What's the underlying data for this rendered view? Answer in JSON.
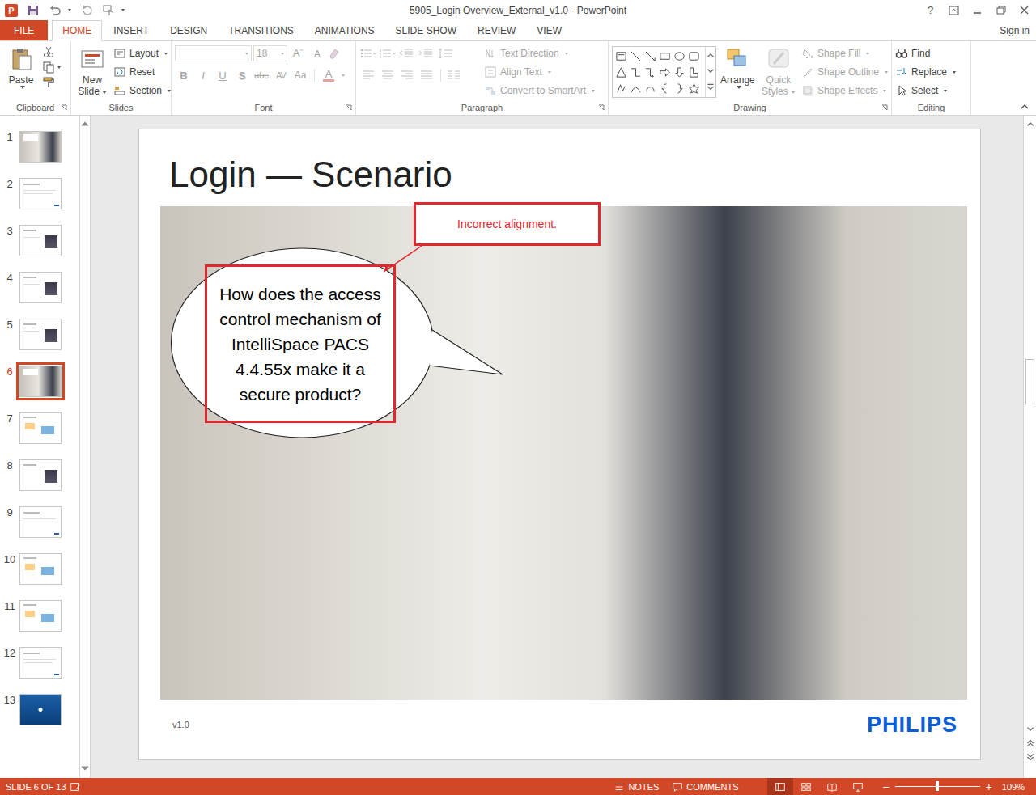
{
  "window": {
    "title": "5905_Login Overview_External_v1.0 - PowerPoint",
    "app_icon": "P",
    "help": "?"
  },
  "tabs": [
    {
      "label": "FILE",
      "selected": false,
      "kind": "file"
    },
    {
      "label": "HOME",
      "selected": true,
      "kind": "tab"
    },
    {
      "label": "INSERT",
      "selected": false,
      "kind": "tab"
    },
    {
      "label": "DESIGN",
      "selected": false,
      "kind": "tab"
    },
    {
      "label": "TRANSITIONS",
      "selected": false,
      "kind": "tab"
    },
    {
      "label": "ANIMATIONS",
      "selected": false,
      "kind": "tab"
    },
    {
      "label": "SLIDE SHOW",
      "selected": false,
      "kind": "tab"
    },
    {
      "label": "REVIEW",
      "selected": false,
      "kind": "tab"
    },
    {
      "label": "VIEW",
      "selected": false,
      "kind": "tab"
    }
  ],
  "account": {
    "label": "Sign in"
  },
  "ribbon": {
    "clipboard": {
      "label": "Clipboard",
      "paste": "Paste"
    },
    "slides": {
      "label": "Slides",
      "new_slide": "New Slide",
      "items": [
        {
          "label": "Layout",
          "dropdown": true
        },
        {
          "label": "Reset",
          "dropdown": false
        },
        {
          "label": "Section",
          "dropdown": true
        }
      ]
    },
    "font": {
      "label": "Font",
      "disabled": true,
      "size": "18",
      "grow": "A",
      "shrink": "A",
      "styles": [
        {
          "label": "B",
          "kind": "bold"
        },
        {
          "label": "I",
          "kind": "italic"
        },
        {
          "label": "U",
          "kind": "underline"
        },
        {
          "label": "S",
          "kind": "shadow"
        },
        {
          "label": "abc",
          "kind": "strike"
        },
        {
          "label": "AV",
          "kind": "spacing"
        },
        {
          "label": "Aa",
          "kind": "case"
        }
      ],
      "color": "A"
    },
    "paragraph": {
      "label": "Paragraph",
      "disabled": true,
      "items": [
        "Text Direction",
        "Align Text",
        "Convert to SmartArt"
      ]
    },
    "drawing": {
      "label": "Drawing",
      "arrange": "Arrange",
      "quick_styles": "Quick Styles",
      "quick_styles_disabled": true,
      "items": [
        "Shape Fill",
        "Shape Outline",
        "Shape Effects"
      ],
      "items_disabled": true
    },
    "editing": {
      "label": "Editing",
      "items": [
        {
          "label": "Find",
          "dropdown": false
        },
        {
          "label": "Replace",
          "dropdown": true
        },
        {
          "label": "Select",
          "dropdown": true
        }
      ]
    }
  },
  "thumbnails": [
    {
      "number": "1",
      "selected": false,
      "kind": "photo"
    },
    {
      "number": "2",
      "selected": false,
      "kind": "text"
    },
    {
      "number": "3",
      "selected": false,
      "kind": "image"
    },
    {
      "number": "4",
      "selected": false,
      "kind": "image"
    },
    {
      "number": "5",
      "selected": false,
      "kind": "image"
    },
    {
      "number": "6",
      "selected": true,
      "kind": "photo"
    },
    {
      "number": "7",
      "selected": false,
      "kind": "diagram"
    },
    {
      "number": "8",
      "selected": false,
      "kind": "image"
    },
    {
      "number": "9",
      "selected": false,
      "kind": "text"
    },
    {
      "number": "10",
      "selected": false,
      "kind": "diagram"
    },
    {
      "number": "11",
      "selected": false,
      "kind": "diagram"
    },
    {
      "number": "12",
      "selected": false,
      "kind": "text"
    },
    {
      "number": "13",
      "selected": false,
      "kind": "dark"
    }
  ],
  "slide": {
    "title": "Login — Scenario",
    "callout": "How does the access control mechanism of IntelliSpace PACS 4.4.55x make it a secure product?",
    "comment": "Incorrect alignment.",
    "footer": "v1.0",
    "logo": "PHILIPS"
  },
  "status_bar": {
    "slide": "SLIDE 6 OF 13",
    "notes": "NOTES",
    "comments": "COMMENTS",
    "views": [
      {
        "kind": "normal",
        "selected": true
      },
      {
        "kind": "sorter",
        "selected": false
      },
      {
        "kind": "reading",
        "selected": false
      },
      {
        "kind": "slideshow",
        "selected": false
      }
    ],
    "zoom_out": "−",
    "zoom_in": "+",
    "zoom_level": 0.5,
    "zoom": "109%"
  }
}
